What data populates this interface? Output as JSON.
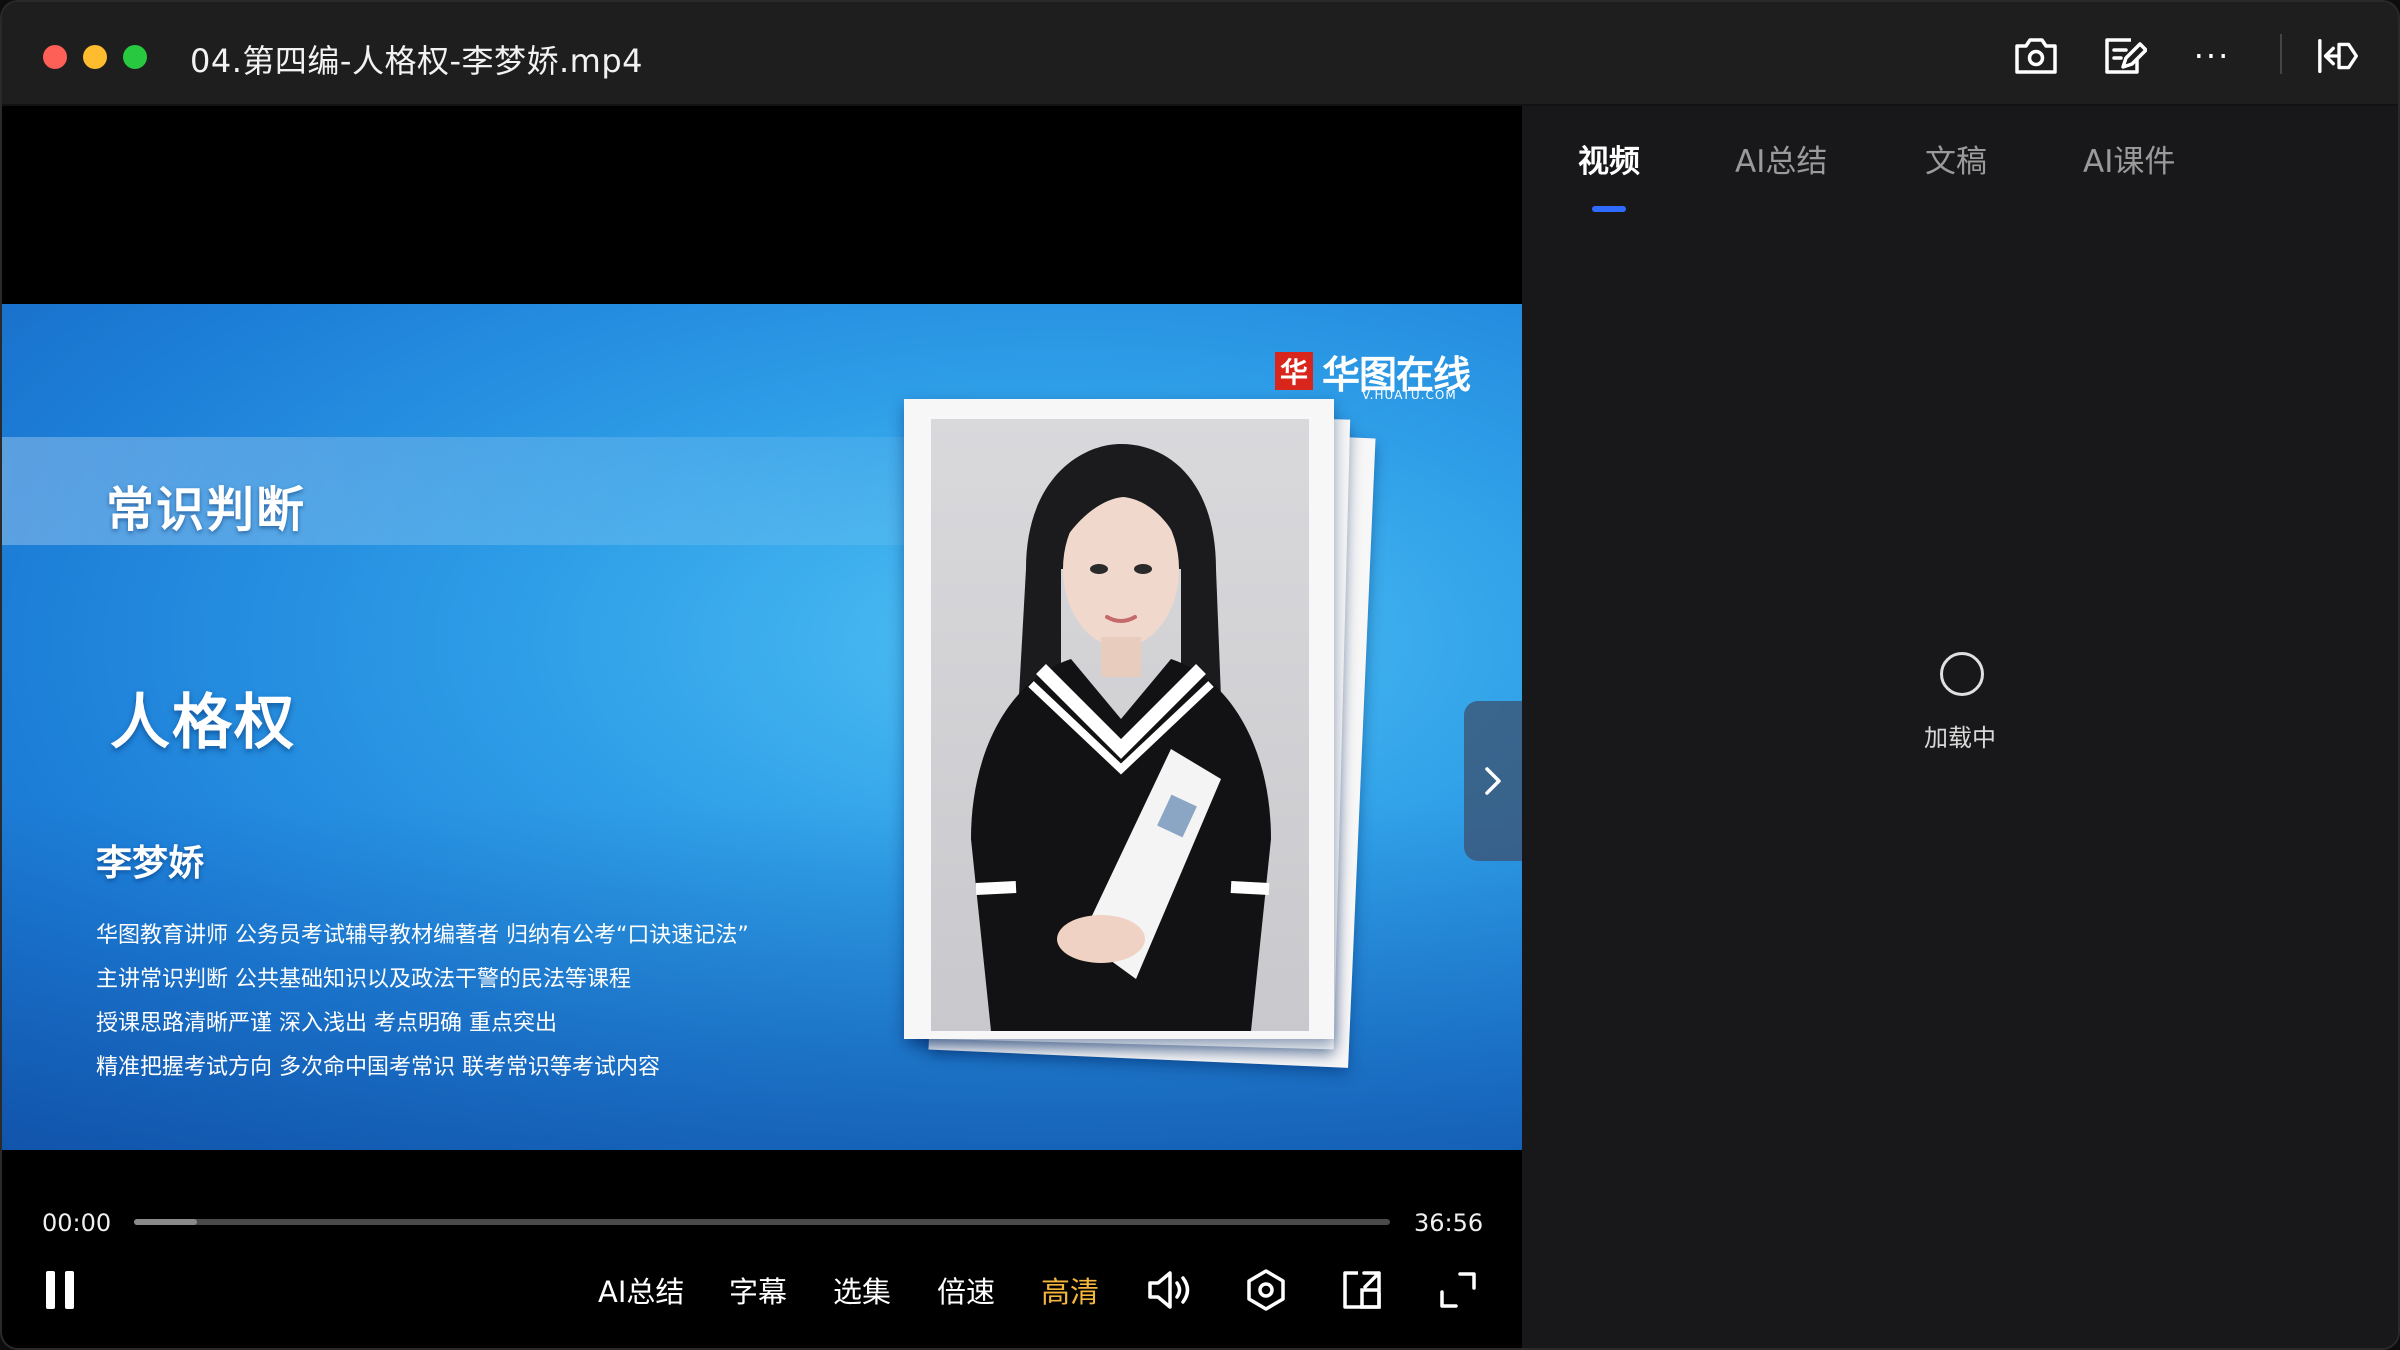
{
  "window": {
    "title": "04.第四编-人格权-李梦娇.mp4"
  },
  "toolbar": {
    "icons": [
      "screenshot-icon",
      "note-edit-icon",
      "more-icon",
      "pin-window-icon"
    ],
    "more_label": "···"
  },
  "slide": {
    "heading": "常识判断",
    "title": "人格权",
    "teacher_name": "李梦娇",
    "bio": [
      "华图教育讲师 公务员考试辅导教材编著者 归纳有公考“口诀速记法”",
      "主讲常识判断  公共基础知识以及政法干警的民法等课程",
      "授课思路清晰严谨  深入浅出  考点明确  重点突出",
      "精准把握考试方向  多次命中国考常识   联考常识等考试内容"
    ],
    "brand_text": "华图在线",
    "brand_sub": "V.HUATU.COM",
    "brand_mark": "华"
  },
  "player": {
    "current_time": "00:00",
    "duration": "36:56",
    "buffered_fraction": 0.05,
    "controls": {
      "ai_summary": "AI总结",
      "subtitles": "字幕",
      "episodes": "选集",
      "speed": "倍速",
      "quality": "高清"
    }
  },
  "panel": {
    "tabs": [
      "视频",
      "AI总结",
      "文稿",
      "AI课件"
    ],
    "active_tab": 0,
    "loading_text": "加载中"
  },
  "colors": {
    "accent": "#2f6bff",
    "quality_highlight": "#f5b73b",
    "traffic_red": "#fe5f57",
    "traffic_yellow": "#febc2e",
    "traffic_green": "#28c840"
  }
}
